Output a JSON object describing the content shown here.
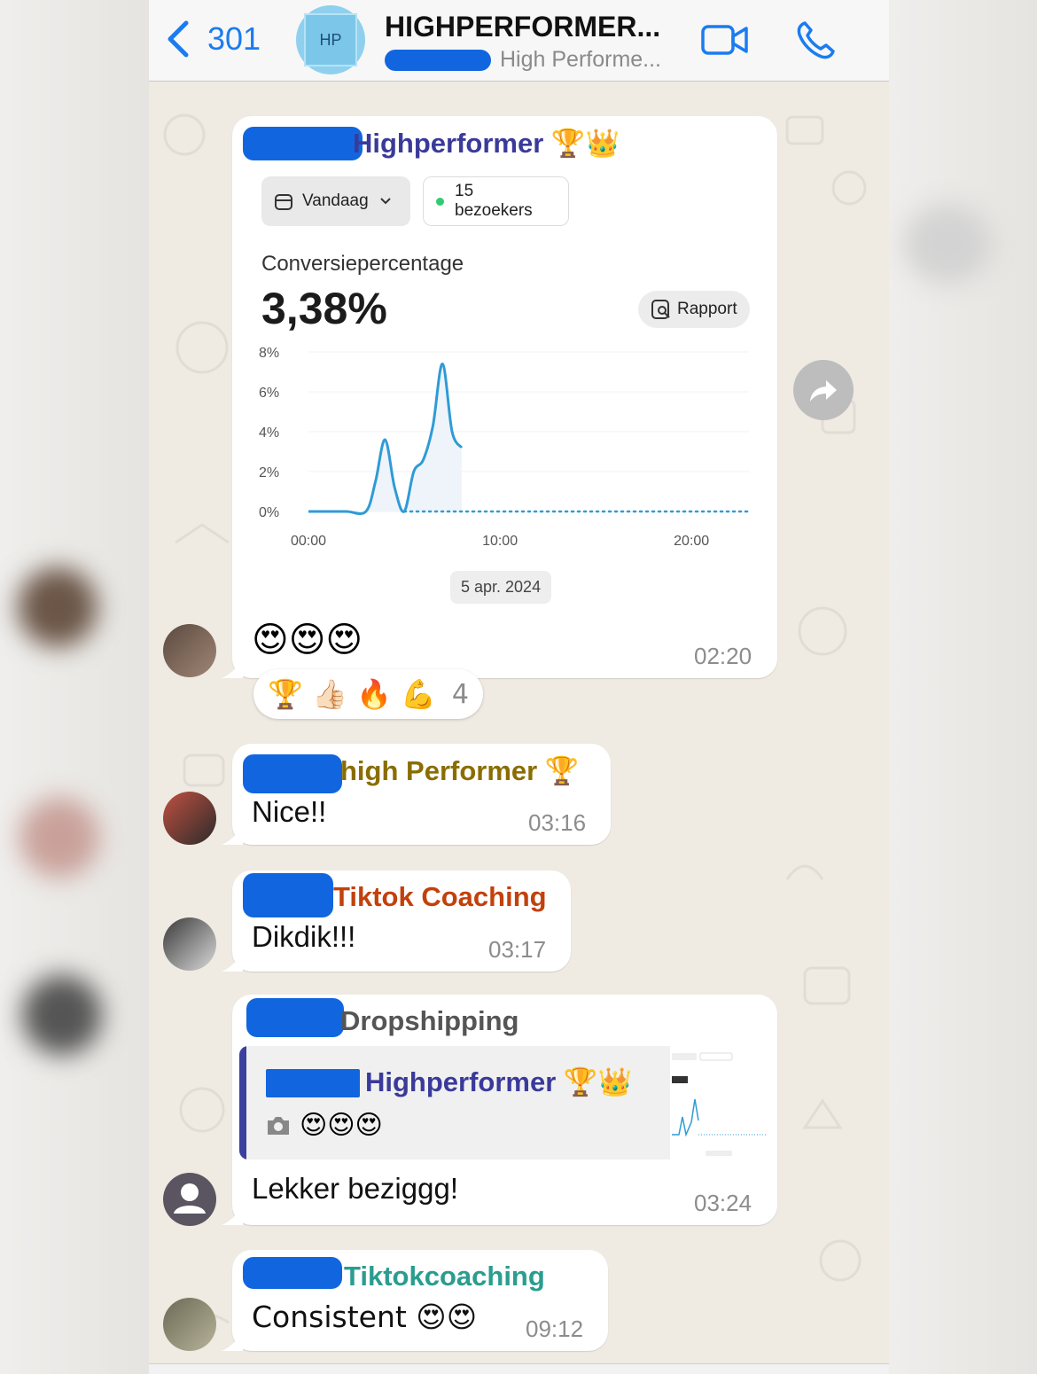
{
  "header": {
    "back_count": "301",
    "title": "HIGHPERFORMER...",
    "subtitle": "High Performe...",
    "avatar_text": "HP"
  },
  "messages": [
    {
      "sender": "Highperformer 🏆👑",
      "sender_color": "#3a3a9a",
      "card": {
        "range_label": "Vandaag",
        "visitors_label": "15 bezoekers",
        "metric_label": "Conversiepercentage",
        "metric_value": "3,38%",
        "report_label": "Rapport",
        "date_label": "5 apr. 2024"
      },
      "text": "😍😍😍",
      "time": "02:20",
      "reactions": {
        "emojis": "🏆 👍🏻 🔥 💪",
        "count": "4"
      }
    },
    {
      "sender": "high Performer 🏆",
      "sender_color": "#8a6d00",
      "text": "Nice!!",
      "time": "03:16"
    },
    {
      "sender": "Tiktok Coaching",
      "sender_color": "#c2410c",
      "text": "Dikdik!!!",
      "time": "03:17"
    },
    {
      "sender": "Dropshipping",
      "sender_color": "#555555",
      "quote": {
        "sender": "Highperformer 🏆👑",
        "content": "😍😍😍"
      },
      "text": "Lekker beziggg!",
      "time": "03:24"
    },
    {
      "sender": "Tiktokcoaching",
      "sender_color": "#2a9d8f",
      "text": "Consistent 😍😍",
      "time": "09:12"
    }
  ],
  "chart_data": {
    "type": "line",
    "x_ticks": [
      "00:00",
      "10:00",
      "20:00"
    ],
    "y_ticks": [
      "8%",
      "6%",
      "4%",
      "2%",
      "0%"
    ],
    "ylim": [
      0,
      8
    ],
    "series": [
      {
        "style": "solid",
        "x": [
          0,
          1,
          2,
          3,
          3.5,
          4,
          4.5,
          5,
          5.5,
          6,
          6.5,
          7,
          7.5,
          8
        ],
        "y": [
          0,
          0,
          0,
          0,
          1.5,
          3.6,
          1.2,
          0,
          2.0,
          2.6,
          4.3,
          7.4,
          4.0,
          3.2
        ]
      },
      {
        "style": "dotted",
        "x": [
          5,
          23
        ],
        "y": [
          0,
          0
        ]
      }
    ],
    "colors": {
      "line": "#2f9bd6",
      "fill": "#eef4fa"
    }
  }
}
